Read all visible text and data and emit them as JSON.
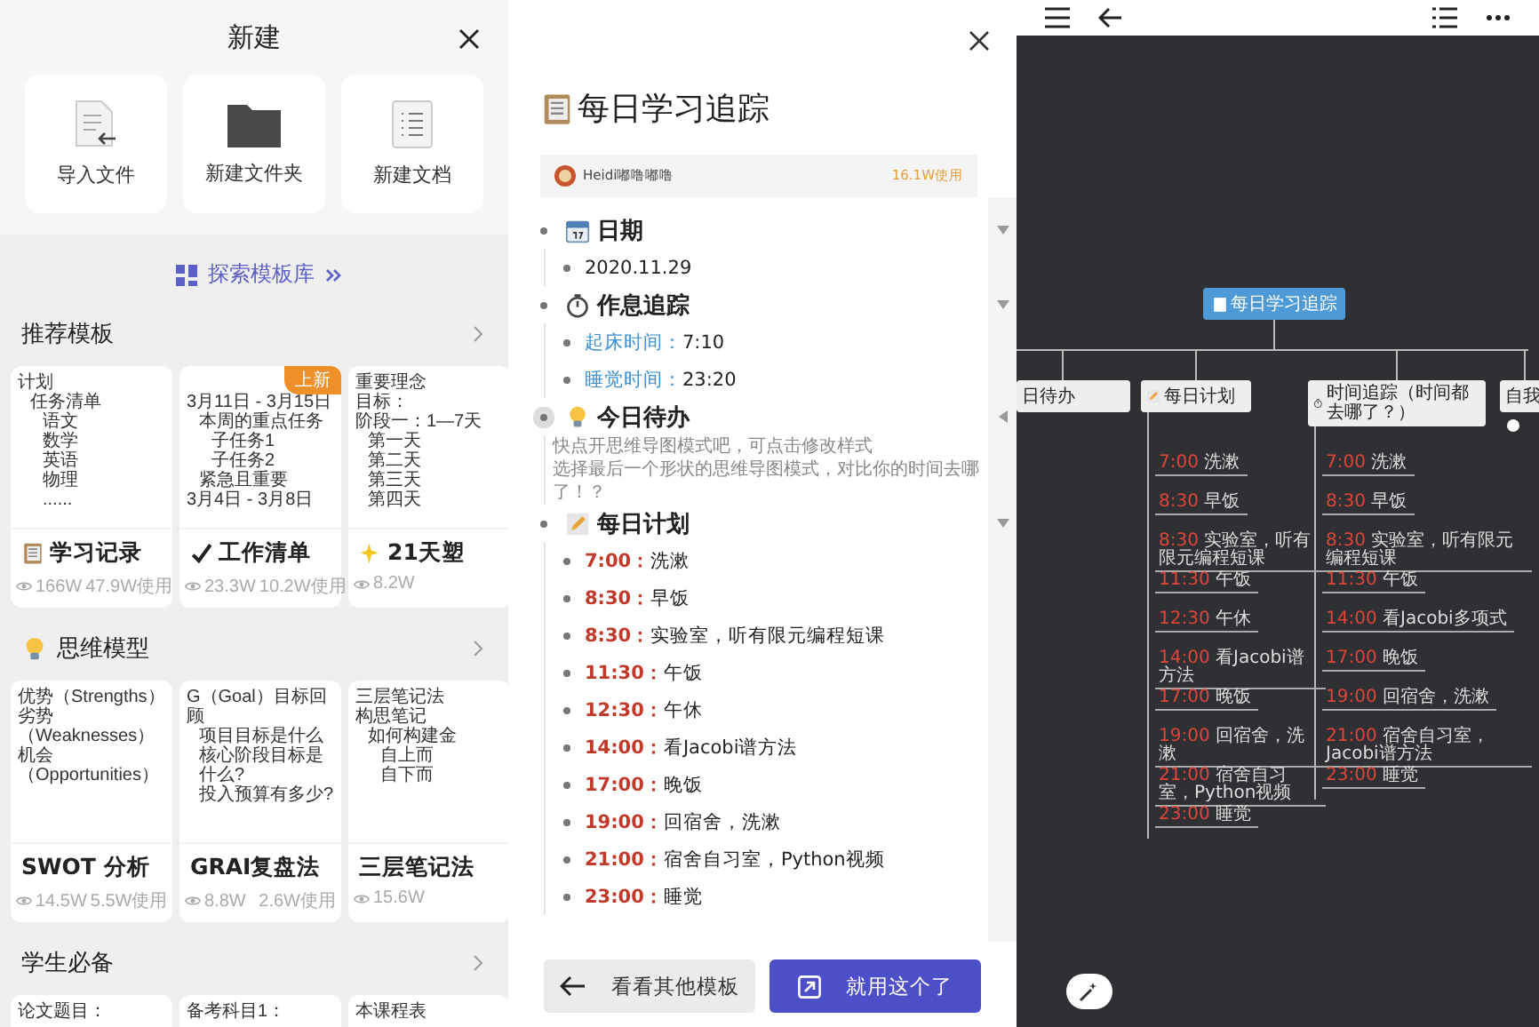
{
  "new_panel": {
    "title": "新建",
    "actions": [
      {
        "kind": "import",
        "label": "导入文件"
      },
      {
        "kind": "folder",
        "label": "新建文件夹"
      },
      {
        "kind": "doc",
        "label": "新建文档"
      }
    ],
    "explore_link": "探索模板库",
    "sections": [
      {
        "title": "推荐模板",
        "cards": [
          {
            "title": "学习记录",
            "views": "166W",
            "uses": "47.9W使用",
            "preview": [
              {
                "text": "计划",
                "children": [
                  {
                    "text": "任务清单",
                    "children": [
                      {
                        "text": "语文"
                      },
                      {
                        "text": "数学"
                      },
                      {
                        "text": "英语"
                      },
                      {
                        "text": "物理"
                      },
                      {
                        "text": "......"
                      }
                    ]
                  }
                ]
              }
            ]
          },
          {
            "title": "工作清单",
            "badge": "上新",
            "views": "23.3W",
            "uses": "10.2W使用",
            "preview": [
              {
                "text": "3月11日 - 3月15日",
                "children": [
                  {
                    "text": "本周的重点任务",
                    "children": [
                      {
                        "text": "子任务1"
                      },
                      {
                        "text": "子任务2"
                      }
                    ]
                  },
                  {
                    "text": "紧急且重要"
                  }
                ]
              },
              {
                "text": "3月4日 - 3月8日"
              }
            ]
          },
          {
            "title": "21天塑",
            "views": "8.2W",
            "preview": [
              {
                "text": "重要理念"
              },
              {
                "text": "目标："
              },
              {
                "text": "阶段一：1—7天",
                "children": [
                  {
                    "text": "第一天"
                  },
                  {
                    "text": "第二天"
                  },
                  {
                    "text": "第三天"
                  },
                  {
                    "text": "第四天"
                  }
                ]
              }
            ]
          }
        ]
      },
      {
        "title": "思维模型",
        "cards": [
          {
            "title": "SWOT 分析",
            "views": "14.5W",
            "uses": "5.5W使用",
            "preview": [
              {
                "text": "优势（Strengths）"
              },
              {
                "text": "劣势（Weaknesses）"
              },
              {
                "text": "机会（Opportunities）"
              }
            ]
          },
          {
            "title": "GRAI复盘法",
            "views": "8.8W",
            "uses": "2.6W使用",
            "preview": [
              {
                "text": "G（Goal）目标回顾",
                "children": [
                  {
                    "text": "项目目标是什么"
                  },
                  {
                    "text": "核心阶段目标是什么?"
                  },
                  {
                    "text": "投入预算有多少?"
                  }
                ]
              }
            ]
          },
          {
            "title": "三层笔记法",
            "views": "15.6W",
            "preview": [
              {
                "text": "三层笔记法"
              },
              {
                "text": "构思笔记",
                "children": [
                  {
                    "text": "如何构建金",
                    "children": [
                      {
                        "text": "自上而"
                      },
                      {
                        "text": "自下而"
                      }
                    ]
                  }
                ]
              }
            ]
          }
        ]
      },
      {
        "title": "学生必备",
        "cards": [
          {
            "preview": [
              {
                "text": "论文题目："
              }
            ]
          },
          {
            "preview": [
              {
                "text": "备考科目1："
              }
            ]
          },
          {
            "preview": [
              {
                "text": "本课程表"
              }
            ]
          }
        ]
      }
    ]
  },
  "template_preview": {
    "title": "每日学习追踪",
    "author": "Heidi嘟噜嘟噜",
    "uses": "16.1W使用",
    "outline": [
      {
        "heading": "日期",
        "selected": false,
        "expanded": true,
        "items": [
          {
            "kind": "plain",
            "text": "2020.11.29"
          }
        ]
      },
      {
        "heading": "作息追踪",
        "selected": false,
        "expanded": true,
        "items": [
          {
            "kind": "field",
            "label": "起床时间：",
            "text": "7:10"
          },
          {
            "kind": "field",
            "label": "睡觉时间：",
            "text": "23:20"
          }
        ]
      },
      {
        "heading": "今日待办",
        "selected": true,
        "expanded": false,
        "items": [
          {
            "kind": "note",
            "text": "快点开思维导图模式吧，可点击修改样式"
          },
          {
            "kind": "note",
            "text": "选择最后一个形状的思维导图模式，对比你的时间去哪了！？"
          }
        ]
      },
      {
        "heading": "每日计划",
        "selected": false,
        "expanded": true,
        "items": [
          {
            "kind": "time",
            "label": "7:00：",
            "text": "洗漱"
          },
          {
            "kind": "time",
            "label": "8:30：",
            "text": "早饭"
          },
          {
            "kind": "time",
            "label": "8:30：",
            "text": "实验室，听有限元编程短课"
          },
          {
            "kind": "time",
            "label": "11:30：",
            "text": "午饭"
          },
          {
            "kind": "time",
            "label": "12:30：",
            "text": "午休"
          },
          {
            "kind": "time",
            "label": "14:00：",
            "text": "看Jacobi谱方法"
          },
          {
            "kind": "time",
            "label": "17:00：",
            "text": "晚饭"
          },
          {
            "kind": "time",
            "label": "19:00：",
            "text": "回宿舍，洗漱"
          },
          {
            "kind": "time",
            "label": "21:00：",
            "text": "宿舍自习室，Python视频"
          },
          {
            "kind": "time",
            "label": "23:00：",
            "text": "睡觉"
          }
        ]
      }
    ],
    "buttons": [
      {
        "kind": "secondary",
        "label": "看看其他模板"
      },
      {
        "kind": "primary",
        "label": "就用这个了"
      }
    ]
  },
  "mindmap": {
    "root": "每日学习追踪",
    "branches": [
      {
        "title": "日待办"
      },
      {
        "title": "每日计划",
        "leaves": [
          {
            "time": "7:00",
            "text": "洗漱"
          },
          {
            "time": "8:30",
            "text": "早饭"
          },
          {
            "time": "8:30",
            "text": "实验室，听有限元编程短课"
          },
          {
            "time": "11:30",
            "text": "午饭"
          },
          {
            "time": "12:30",
            "text": "午休"
          },
          {
            "time": "14:00",
            "text": "看Jacobi谱方法"
          },
          {
            "time": "17:00",
            "text": "晚饭"
          },
          {
            "time": "19:00",
            "text": "回宿舍，洗漱"
          },
          {
            "time": "21:00",
            "text": "宿舍自习室，Python视频"
          },
          {
            "time": "23:00",
            "text": "睡觉"
          }
        ]
      },
      {
        "title": "时间追踪（时间都去哪了？）",
        "leaves": [
          {
            "time": "7:00",
            "text": "洗漱"
          },
          {
            "time": "8:30",
            "text": "早饭"
          },
          {
            "time": "8:30",
            "text": "实验室，听有限元编程短课"
          },
          {
            "time": "11:30",
            "text": "午饭"
          },
          {
            "time": "14:00",
            "text": "看Jacobi多项式"
          },
          {
            "time": "17:00",
            "text": "晚饭"
          },
          {
            "time": "19:00",
            "text": "回宿舍，洗漱"
          },
          {
            "time": "21:00",
            "text": "宿舍自习室，Jacobi谱方法"
          },
          {
            "time": "23:00",
            "text": "睡觉"
          }
        ]
      },
      {
        "title": "自我"
      }
    ]
  }
}
